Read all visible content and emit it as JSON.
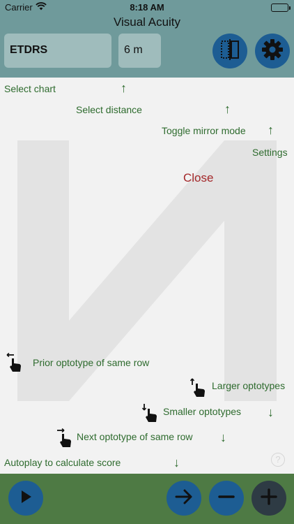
{
  "status_bar": {
    "carrier": "Carrier",
    "time": "8:18 AM"
  },
  "header": {
    "title": "Visual Acuity",
    "chart_select_value": "ETDRS",
    "distance_select_value": "6 m",
    "mirror_icon": "mirror-toggle-icon",
    "settings_icon": "gear-icon"
  },
  "help_overlay": {
    "select_chart": "Select chart",
    "select_distance": "Select distance",
    "toggle_mirror": "Toggle mirror mode",
    "settings": "Settings",
    "close": "Close",
    "prior_optotype": "Prior optotype of same row",
    "larger_optotypes": "Larger optotypes",
    "smaller_optotypes": "Smaller optotypes",
    "next_optotype": "Next optotype of same row",
    "autoplay": "Autoplay to calculate score",
    "arrow_up": "↑",
    "arrow_down": "↓",
    "question_mark": "?"
  },
  "toolbar": {
    "play_icon": "play-icon",
    "next_icon": "arrow-right-icon",
    "minus_icon": "minus-icon",
    "plus_icon": "plus-icon"
  },
  "colors": {
    "header_bg": "#6f9a9b",
    "button_blue": "#1d5d93",
    "bottom_bar": "#4e7a44",
    "help_green": "#2e6b2e",
    "close_red": "#a4282a"
  }
}
